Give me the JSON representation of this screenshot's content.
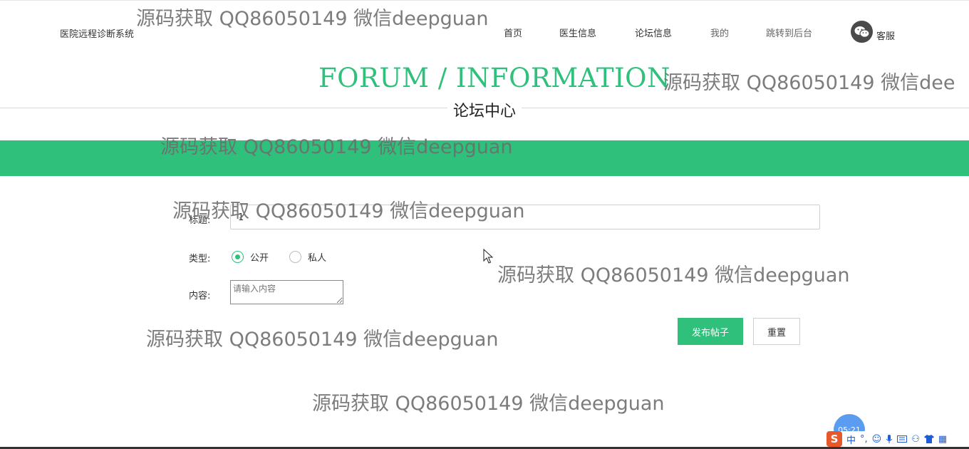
{
  "header": {
    "brand": "医院远程诊断系统",
    "nav": [
      "首页",
      "医生信息",
      "论坛信息",
      "我的",
      "跳转到后台"
    ],
    "service_label": "客服"
  },
  "hero": {
    "title_en": "FORUM / INFORMATION",
    "title_cn": "论坛中心"
  },
  "form": {
    "title_label": "标题:",
    "title_value": "1",
    "type_label": "类型:",
    "type_options": [
      "公开",
      "私人"
    ],
    "type_selected": "公开",
    "content_label": "内容:",
    "content_placeholder": "请输入内容",
    "submit_label": "发布帖子",
    "reset_label": "重置"
  },
  "watermark": {
    "text": "源码获取 QQ86050149 微信deepguan",
    "text_cut": "源码获取 QQ86050149 微信dee"
  },
  "taskbar": {
    "clock": "05:21",
    "ime_mode": "中"
  },
  "colors": {
    "accent": "#2fc17c",
    "text": "#333333"
  },
  "icons": [
    "wechat-service-icon",
    "mouse-cursor-icon",
    "sogou-ime-icon"
  ]
}
